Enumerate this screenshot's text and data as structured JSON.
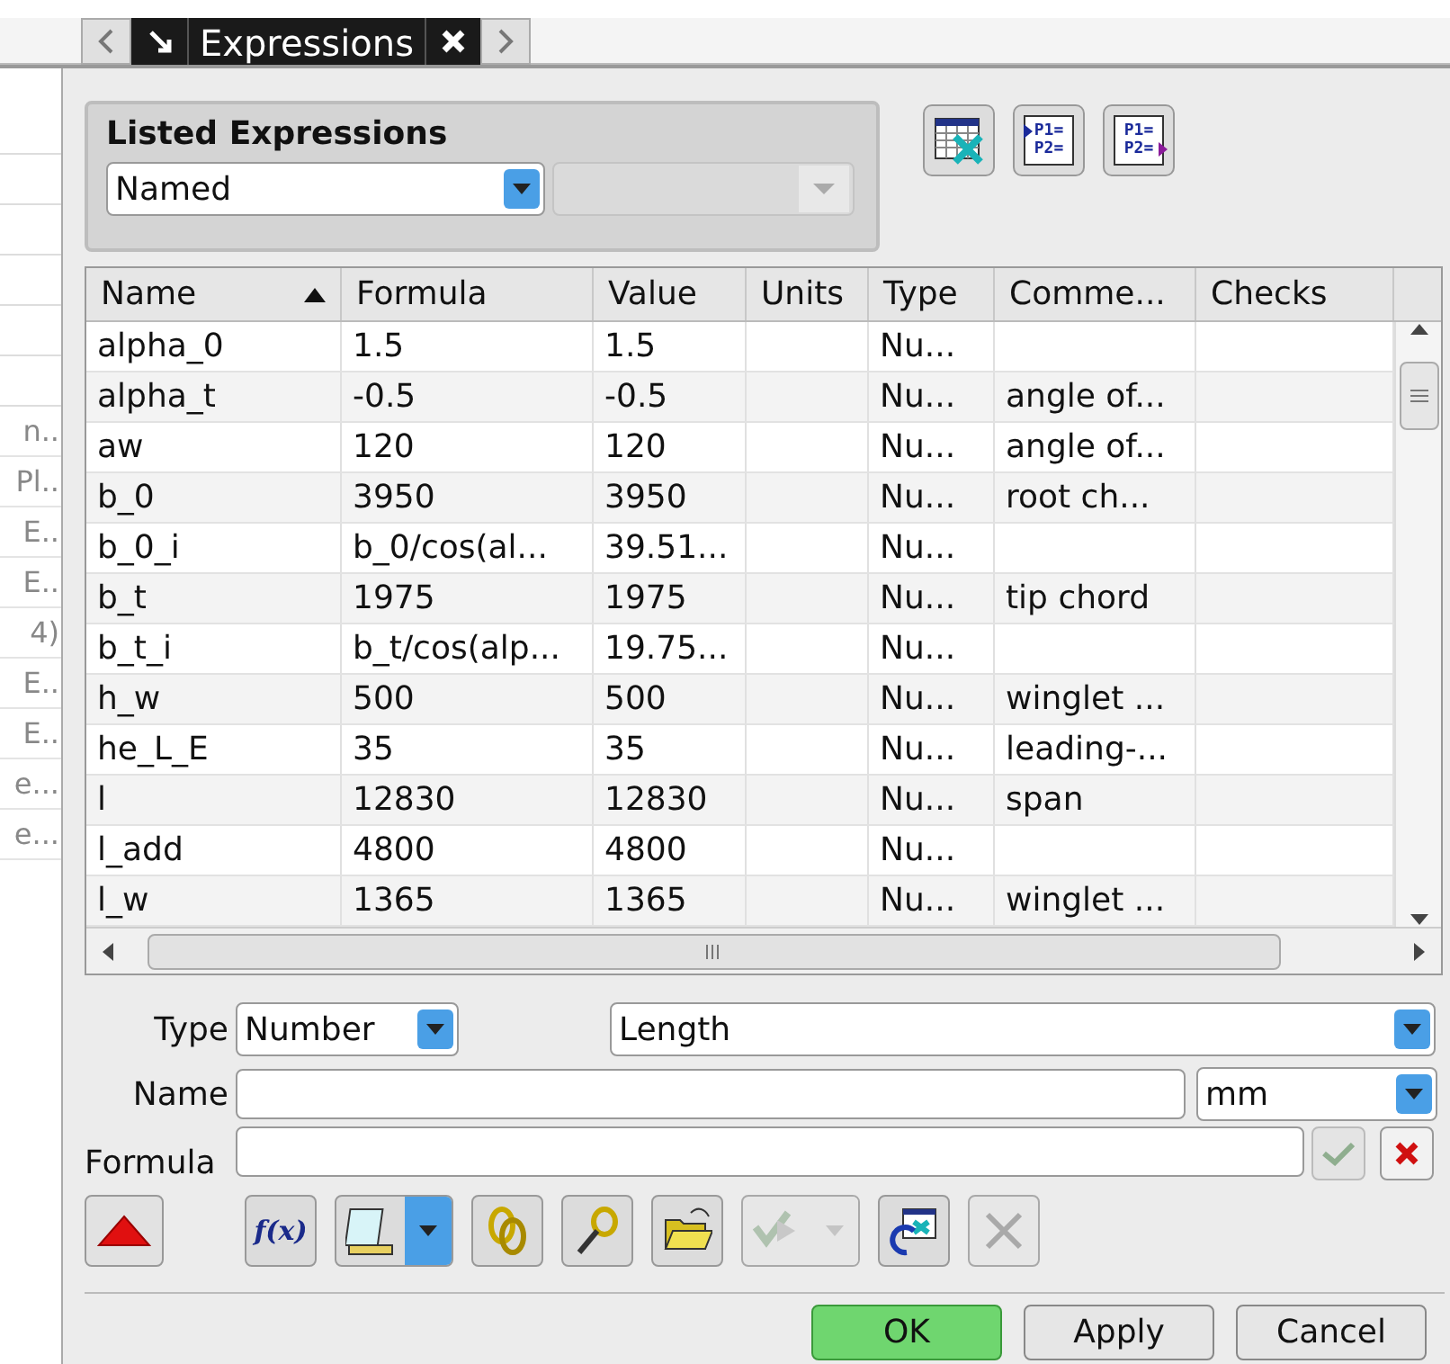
{
  "side_panel": {
    "items": [
      "n..",
      "Pl..",
      "E..",
      "E..",
      "4)",
      "E..",
      "E..",
      "e...",
      "e..."
    ]
  },
  "tab_bar": {
    "title": "Expressions"
  },
  "listed_expressions": {
    "title": "Listed Expressions",
    "filter": "Named"
  },
  "list_tools": [
    {
      "kind": "spreadsheet"
    },
    {
      "kind": "import",
      "lines": [
        "P1=",
        "P2="
      ]
    },
    {
      "kind": "export",
      "lines": [
        "P1=",
        "P2="
      ]
    }
  ],
  "table": {
    "columns": [
      {
        "label": "Name",
        "sorted": true
      },
      {
        "label": "Formula",
        "sorted": false
      },
      {
        "label": "Value",
        "sorted": false
      },
      {
        "label": "Units",
        "sorted": false
      },
      {
        "label": "Type",
        "sorted": false
      },
      {
        "label": "Comme...",
        "sorted": false
      },
      {
        "label": "Checks",
        "sorted": false
      }
    ],
    "rows": [
      [
        "alpha_0",
        "1.5",
        "1.5",
        "",
        "Nu...",
        "",
        ""
      ],
      [
        "alpha_t",
        "-0.5",
        "-0.5",
        "",
        "Nu...",
        "angle of...",
        ""
      ],
      [
        "aw",
        "120",
        "120",
        "",
        "Nu...",
        "angle of...",
        ""
      ],
      [
        "b_0",
        "3950",
        "3950",
        "",
        "Nu...",
        "root ch...",
        ""
      ],
      [
        "b_0_i",
        "b_0/cos(al...",
        "39.51...",
        "",
        "Nu...",
        "",
        ""
      ],
      [
        "b_t",
        "1975",
        "1975",
        "",
        "Nu...",
        "tip chord",
        ""
      ],
      [
        "b_t_i",
        "b_t/cos(alp...",
        "19.75...",
        "",
        "Nu...",
        "",
        ""
      ],
      [
        "h_w",
        "500",
        "500",
        "",
        "Nu...",
        "winglet ...",
        ""
      ],
      [
        "he_L_E",
        "35",
        "35",
        "",
        "Nu...",
        "leading-...",
        ""
      ],
      [
        "l",
        "12830",
        "12830",
        "",
        "Nu...",
        "span",
        ""
      ],
      [
        "l_add",
        "4800",
        "4800",
        "",
        "Nu...",
        "",
        ""
      ],
      [
        "l_w",
        "1365",
        "1365",
        "",
        "Nu...",
        "winglet ...",
        ""
      ]
    ]
  },
  "form": {
    "type_label": "Type",
    "type_value": "Number",
    "dimension": "Length",
    "name_label": "Name",
    "unit": "mm",
    "formula_label": "Formula",
    "accept_disabled": true
  },
  "tools": [
    {
      "kind": "function",
      "label": "f(x)",
      "disabled": false
    },
    {
      "kind": "measure",
      "disabled": false
    },
    {
      "kind": "link",
      "disabled": false
    },
    {
      "kind": "chain",
      "disabled": false
    },
    {
      "kind": "open",
      "disabled": false
    },
    {
      "kind": "apply",
      "disabled": true
    },
    {
      "kind": "refresh",
      "disabled": false
    },
    {
      "kind": "delete",
      "disabled": true
    }
  ],
  "buttons": [
    {
      "label": "OK",
      "default": true
    },
    {
      "label": "Apply",
      "default": false
    },
    {
      "label": "Cancel",
      "default": false
    }
  ]
}
